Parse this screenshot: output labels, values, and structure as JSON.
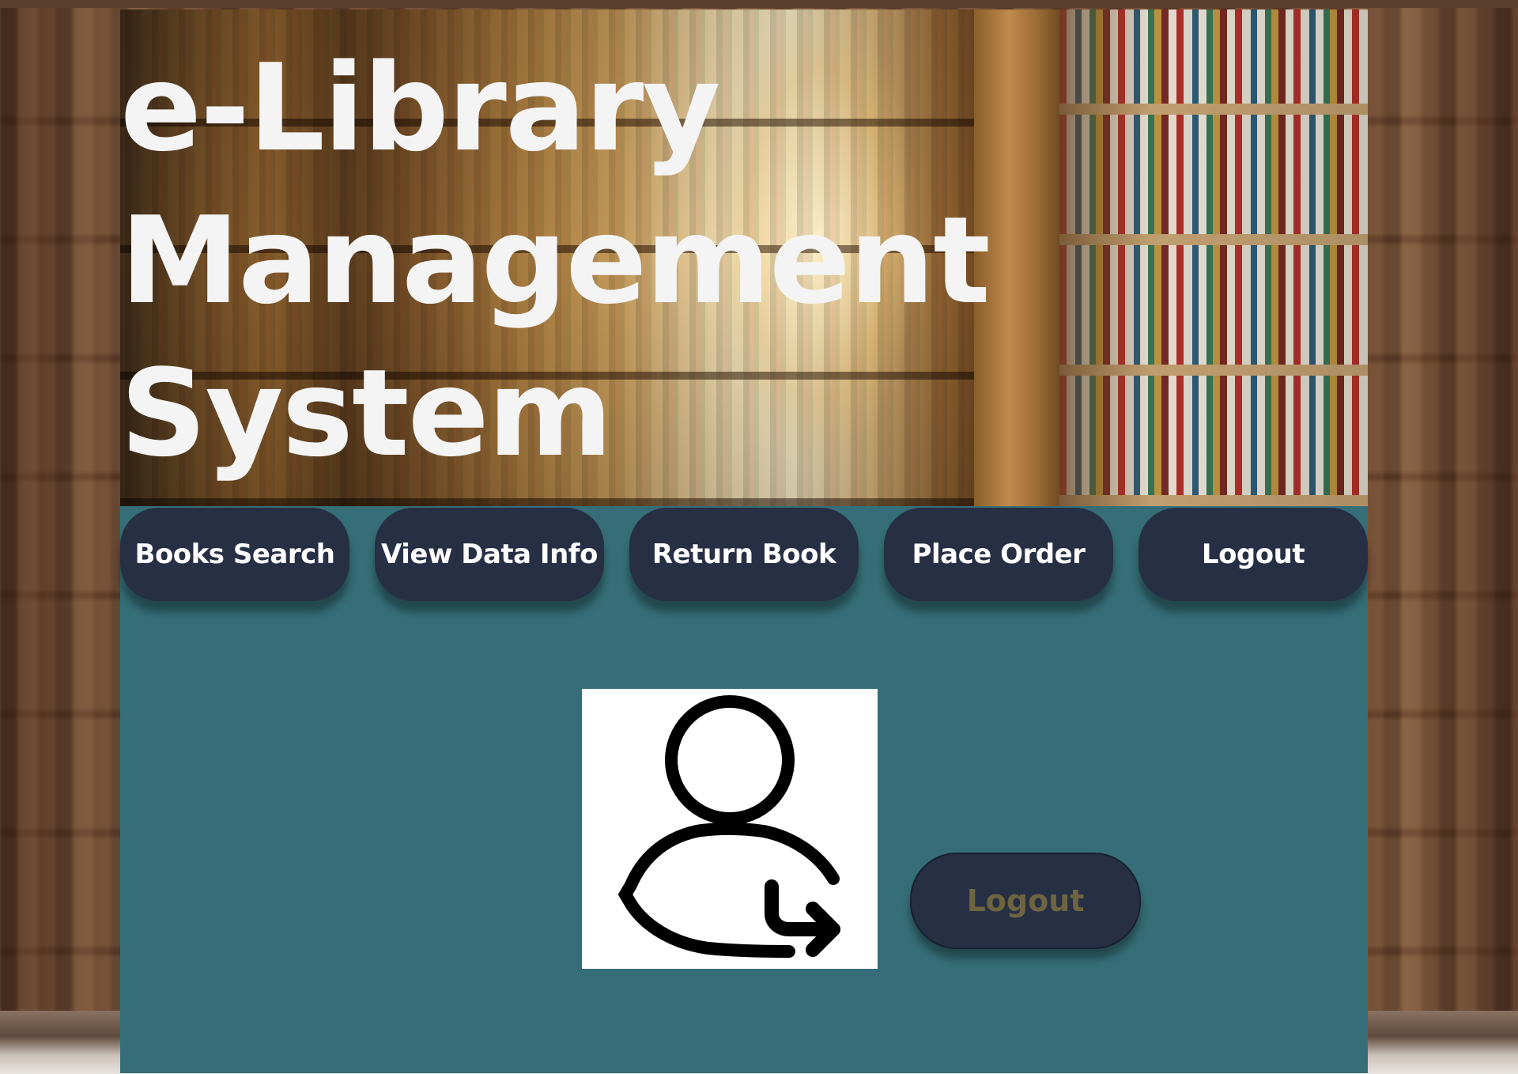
{
  "header": {
    "title_line1": "e-Library",
    "title_line2": "Management",
    "title_line3": "System"
  },
  "nav": {
    "items": [
      {
        "label": "Books Search"
      },
      {
        "label": "View Data Info"
      },
      {
        "label": "Return Book"
      },
      {
        "label": "Place Order"
      },
      {
        "label": "Logout"
      }
    ]
  },
  "main": {
    "icon": "user-logout-icon",
    "logout_label": "Logout"
  },
  "colors": {
    "main_bg": "#356e78",
    "button_bg": "#272f44",
    "button_text": "#ffffff",
    "logout_text": "#6e6540",
    "title_text": "#f4f4f4"
  }
}
